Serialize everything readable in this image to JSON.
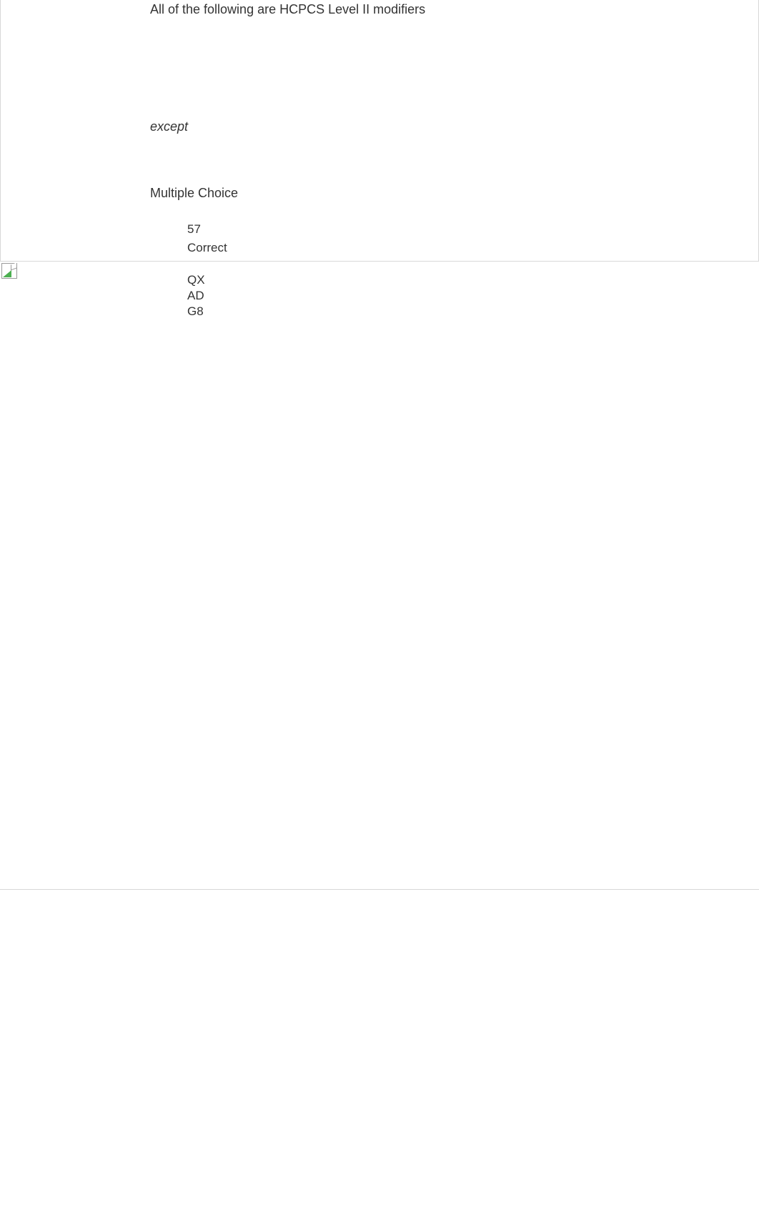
{
  "question": {
    "stem": "All of the following are HCPCS Level II modifiers",
    "exception_word": "except",
    "type_label": "Multiple Choice",
    "answer": {
      "value": "57",
      "status": "Correct"
    },
    "options": [
      "QX",
      "AD",
      "G8"
    ]
  }
}
